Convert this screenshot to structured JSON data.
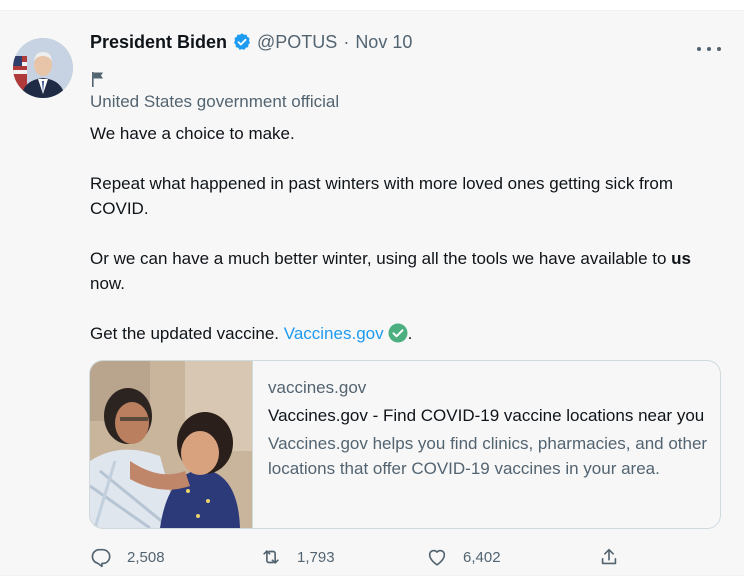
{
  "tweet": {
    "author_name": "President Biden",
    "handle": "@POTUS",
    "separator": "·",
    "date": "Nov 10",
    "label": "United States government official",
    "lines": {
      "l1": "We have a choice to make.",
      "l2": "Repeat what happened in past winters with more loved ones getting sick from COVID.",
      "l3a": "Or we can have a much better winter, using all the tools we have available to ",
      "l3b": "us",
      "l3c": " now.",
      "l4a": "Get the updated vaccine. ",
      "l4link": "Vaccines.gov",
      "l4end": "."
    },
    "card": {
      "domain": "vaccines.gov",
      "title": "Vaccines.gov - Find COVID-19 vaccine locations near you",
      "description": "Vaccines.gov helps you find clinics, pharmacies, and other locations that offer COVID-19 vaccines in your area."
    },
    "actions": {
      "replies": "2,508",
      "retweets": "1,793",
      "likes": "6,402"
    },
    "icons": {
      "verified": "verified-badge-icon",
      "flag": "flag-icon",
      "link_check": "check-circle-icon",
      "reply": "reply-icon",
      "retweet": "retweet-icon",
      "like": "heart-icon",
      "share": "share-icon",
      "more": "more-icon"
    },
    "colors": {
      "accent": "#1d9bf0",
      "secondary_text": "#536471",
      "background": "#f7f7f7",
      "check_green": "#4caf80"
    }
  }
}
